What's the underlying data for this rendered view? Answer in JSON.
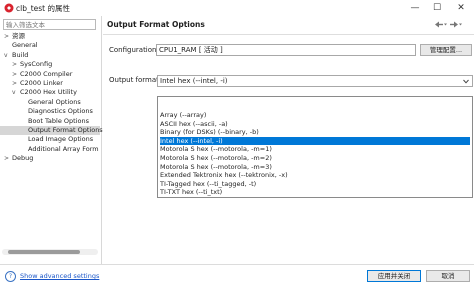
{
  "window": {
    "title": "clb_test 的属性",
    "minimize": "—",
    "maximize": "☐",
    "close": "✕"
  },
  "filter": {
    "placeholder": "输入筛选文本"
  },
  "tree": [
    {
      "label": "资源",
      "twisty": ">",
      "indent": 0
    },
    {
      "label": "General",
      "twisty": "",
      "indent": 0
    },
    {
      "label": "Build",
      "twisty": "v",
      "indent": 0
    },
    {
      "label": "SysConfig",
      "twisty": ">",
      "indent": 1
    },
    {
      "label": "C2000 Compiler",
      "twisty": ">",
      "indent": 1
    },
    {
      "label": "C2000 Linker",
      "twisty": ">",
      "indent": 1
    },
    {
      "label": "C2000 Hex Utility",
      "twisty": "v",
      "indent": 1
    },
    {
      "label": "General Options",
      "twisty": "",
      "indent": 2
    },
    {
      "label": "Diagnostics Options",
      "twisty": "",
      "indent": 2
    },
    {
      "label": "Boot Table Options",
      "twisty": "",
      "indent": 2
    },
    {
      "label": "Output Format Options",
      "twisty": "",
      "indent": 2,
      "selected": true
    },
    {
      "label": "Load Image Options",
      "twisty": "",
      "indent": 2
    },
    {
      "label": "Additional Array Form",
      "twisty": "",
      "indent": 2
    },
    {
      "label": "Debug",
      "twisty": ">",
      "indent": 0
    }
  ],
  "main": {
    "title": "Output Format Options",
    "configuration_label": "Configuration:",
    "configuration_value": "CPU1_RAM  [ 活动 ]",
    "manage_button": "管理配置...",
    "output_format_label": "Output format",
    "output_format_value": "Intel hex (--intel, -i)"
  },
  "dropdown_options": [
    {
      "label": "Array (--array)"
    },
    {
      "label": "ASCII hex (--ascii, -a)"
    },
    {
      "label": "Binary (for DSKs) (--binary, -b)"
    },
    {
      "label": "Intel hex (--intel, -i)",
      "selected": true
    },
    {
      "label": "Motorola S hex (--motorola, -m=1)"
    },
    {
      "label": "Motorola S hex (--motorola, -m=2)"
    },
    {
      "label": "Motorola S hex (--motorola, -m=3)"
    },
    {
      "label": "Extended Tektronix hex (--tektronix, -x)"
    },
    {
      "label": "TI-Tagged hex (--ti_tagged, -t)"
    },
    {
      "label": "TI-TXT hex (--ti_txt)"
    }
  ],
  "bottom": {
    "help": "?",
    "advanced_link": "Show advanced settings",
    "apply_close": "应用并关闭",
    "cancel": "取消"
  }
}
